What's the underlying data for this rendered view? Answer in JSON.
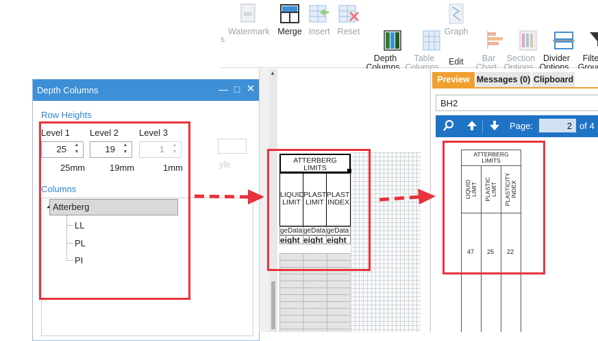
{
  "ribbon": {
    "left_partial_label": "s",
    "buttons": [
      {
        "label": "Watermark",
        "icon": "abc-watermark-icon",
        "enabled": false
      },
      {
        "label": "Merge",
        "icon": "merge-grid-icon",
        "enabled": true
      },
      {
        "label": "Insert",
        "icon": "insert-table-icon",
        "enabled": false
      },
      {
        "label": "Reset",
        "icon": "reset-table-icon",
        "enabled": false
      },
      {
        "label": "Depth\nColumns",
        "icon": "depth-columns-icon",
        "enabled": true
      },
      {
        "label": "Table\nColumns",
        "icon": "table-columns-icon",
        "enabled": false
      },
      {
        "label": "Graph",
        "icon": "graph-icon",
        "enabled": false
      },
      {
        "label": "Bar\nChart",
        "icon": "bar-chart-icon",
        "enabled": false
      },
      {
        "label": "Section\nOptions",
        "icon": "section-options-icon",
        "enabled": false
      },
      {
        "label": "Divider\nOptions",
        "icon": "divider-options-icon",
        "enabled": true
      },
      {
        "label": "Filter\nGroup",
        "icon": "filter-icon",
        "enabled": true
      }
    ],
    "group_label": "Edit"
  },
  "depth_columns": {
    "title": "Depth Columns",
    "row_heights_label": "Row Heights",
    "levels": [
      {
        "label": "Level 1",
        "value": "25",
        "mm": "25mm",
        "enabled": true
      },
      {
        "label": "Level 2",
        "value": "19",
        "mm": "19mm",
        "enabled": true
      },
      {
        "label": "Level 3",
        "value": "1",
        "mm": "1mm",
        "enabled": false
      }
    ],
    "background_text": "yle",
    "columns_label": "Columns",
    "tree": {
      "root": "Atterberg",
      "children": [
        "LL",
        "PL",
        "PI"
      ]
    }
  },
  "designer": {
    "header": "ATTERBERG\nLIMITS",
    "columns": [
      "LIQUID\nLIMIT",
      "PLASTIC\nLIMIT",
      "PLASTIC\nINDEX"
    ],
    "bind_row1": [
      "geData",
      "geData",
      "geData"
    ],
    "bind_row2": [
      "eight",
      "eight",
      "eight"
    ]
  },
  "preview": {
    "tabs": [
      "Preview",
      "Messages (0)",
      "Clipboard"
    ],
    "borehole": "BH2",
    "page_label": "Page:",
    "page_value": "2",
    "page_of": "of 4",
    "table": {
      "header": "ATTERBERG\nLIMITS",
      "columns": [
        "LIQUID\nLIMIT",
        "PLASTIC\nLIMIT",
        "PLASTICITY\nINDEX"
      ],
      "values": [
        "47",
        "25",
        "22"
      ]
    }
  },
  "colors": {
    "accent_blue": "#3d8fd6",
    "highlight_red": "#e8323c",
    "preview_tab_orange": "#f0a030",
    "toolbar_blue": "#1f73c5"
  }
}
